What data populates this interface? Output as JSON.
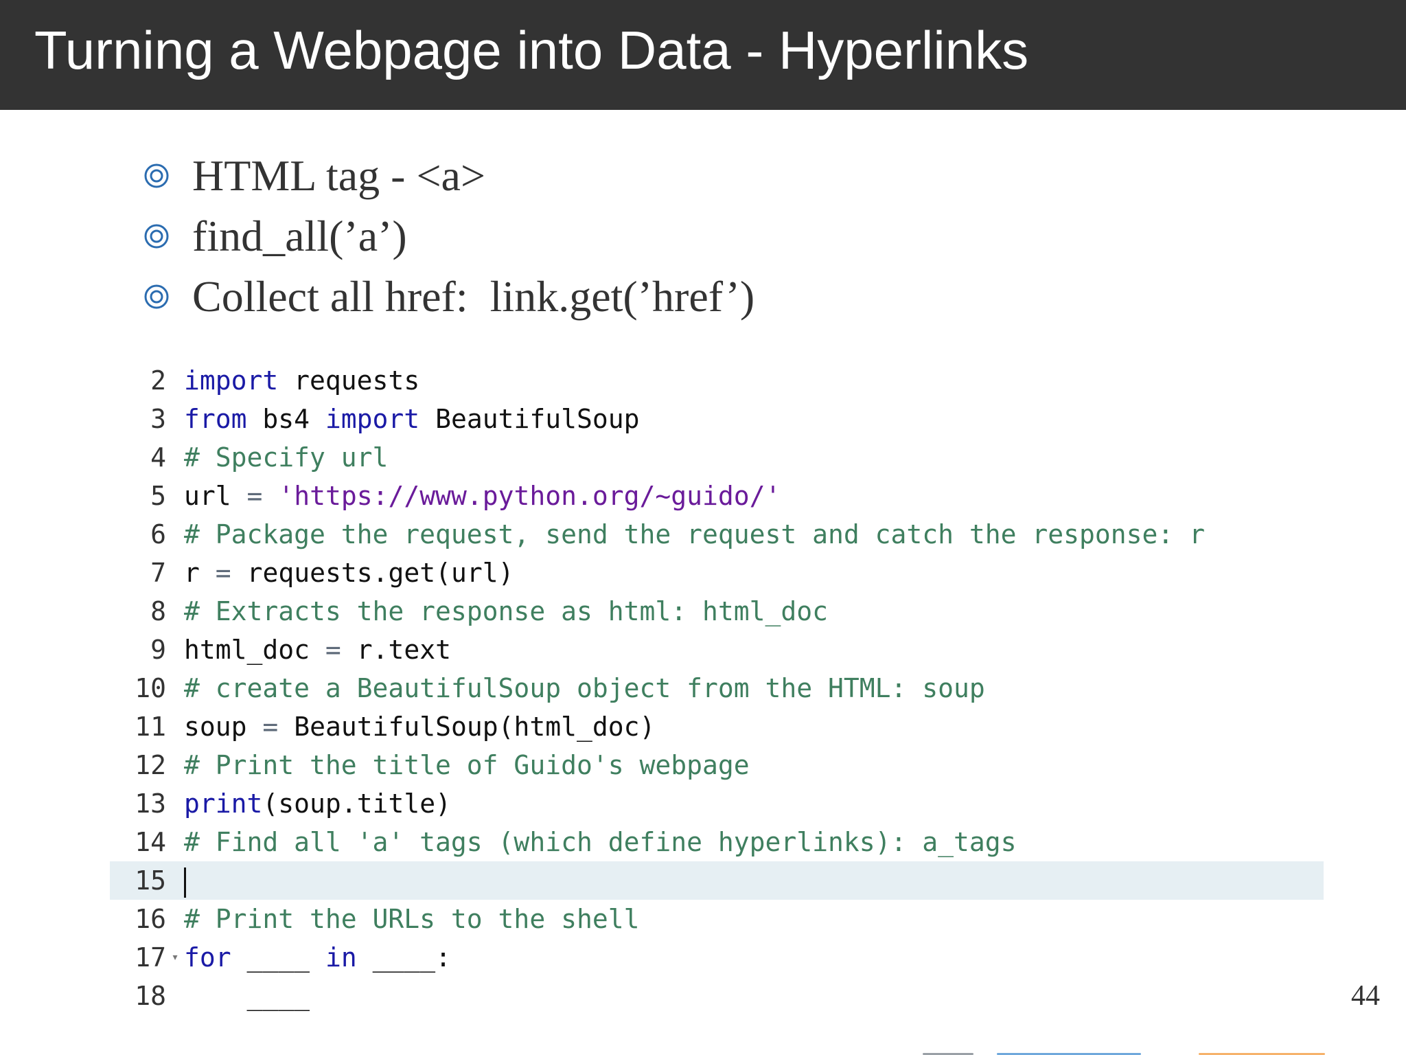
{
  "slide": {
    "title": "Turning a Webpage into Data - Hyperlinks",
    "page_number": "44",
    "bullets": [
      {
        "icon": "circle-bullet-icon",
        "text": "HTML tag - <a>"
      },
      {
        "icon": "circle-bullet-icon",
        "text": "find_all(’a’)"
      },
      {
        "icon": "circle-bullet-icon",
        "text": "Collect all href:  link.get(’href’)"
      }
    ]
  },
  "colors": {
    "title_bar": "#333333",
    "bullet_icon": "#2b6cb0",
    "keyword": "#1a1aa6",
    "comment": "#3f7f5f",
    "string": "#6a1b9a",
    "active_line": "#e6eff3"
  },
  "editor": {
    "active_line_number": "15",
    "lines": [
      {
        "num": "2",
        "text": "import requests"
      },
      {
        "num": "3",
        "text": "from bs4 import BeautifulSoup"
      },
      {
        "num": "4",
        "text": "# Specify url"
      },
      {
        "num": "5",
        "text": "url = 'https://www.python.org/~guido/'"
      },
      {
        "num": "6",
        "text": "# Package the request, send the request and catch the response: r"
      },
      {
        "num": "7",
        "text": "r = requests.get(url)"
      },
      {
        "num": "8",
        "text": "# Extracts the response as html: html_doc"
      },
      {
        "num": "9",
        "text": "html_doc = r.text"
      },
      {
        "num": "10",
        "text": "# create a BeautifulSoup object from the HTML: soup"
      },
      {
        "num": "11",
        "text": "soup = BeautifulSoup(html_doc)"
      },
      {
        "num": "12",
        "text": "# Print the title of Guido's webpage"
      },
      {
        "num": "13",
        "text": "print(soup.title)"
      },
      {
        "num": "14",
        "text": "# Find all 'a' tags (which define hyperlinks): a_tags"
      },
      {
        "num": "15",
        "text": ""
      },
      {
        "num": "16",
        "text": "# Print the URLs to the shell"
      },
      {
        "num": "17",
        "text": "for ____ in ____:"
      },
      {
        "num": "18",
        "text": "    ____"
      }
    ]
  }
}
